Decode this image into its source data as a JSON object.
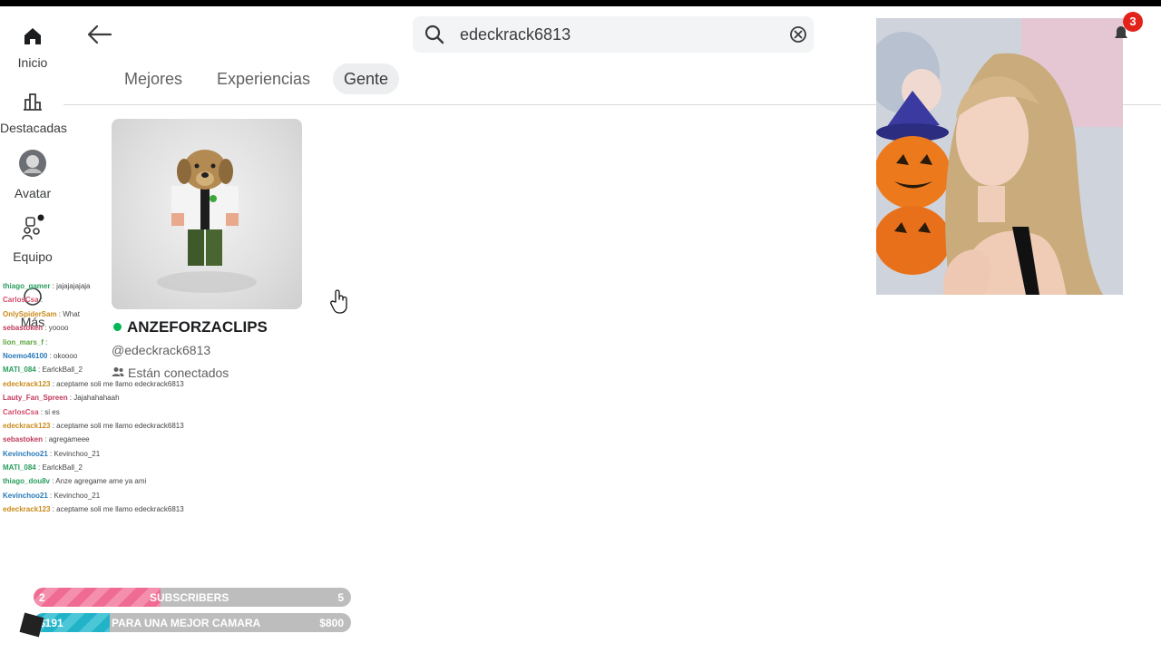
{
  "nav": {
    "items": [
      {
        "label": "Inicio",
        "icon": "home-icon"
      },
      {
        "label": "Destacadas",
        "icon": "chart-icon"
      },
      {
        "label": "Avatar",
        "icon": "avatar-icon"
      },
      {
        "label": "Equipo",
        "icon": "party-icon"
      },
      {
        "label": "Más",
        "icon": "more-icon"
      }
    ]
  },
  "search": {
    "value": "edeckrack6813",
    "icon": "search-icon",
    "clear_icon": "clear-icon"
  },
  "tabs": [
    {
      "label": "Mejores",
      "active": false
    },
    {
      "label": "Experiencias",
      "active": false
    },
    {
      "label": "Gente",
      "active": true
    }
  ],
  "result": {
    "display_name": "ANZEFORZACLIPS",
    "username": "@edeckrack6813",
    "status": "Están conectados",
    "online": true
  },
  "notifications": {
    "count": "3"
  },
  "chat": [
    {
      "user": "thiago_gamer",
      "msg": "jajajajajaja",
      "color": "#2a9d5c"
    },
    {
      "user": "CarlosCsa",
      "msg": "",
      "color": "#d44a6a"
    },
    {
      "user": "OnlySpiderSam",
      "msg": "What",
      "color": "#c98b1a"
    },
    {
      "user": "sebastoken",
      "msg": "yoooo",
      "color": "#c0395b"
    },
    {
      "user": "lion_mars_f",
      "msg": "",
      "color": "#5aa53a"
    },
    {
      "user": "Noemo46100",
      "msg": "okoooo",
      "color": "#2a7ab8"
    },
    {
      "user": "MATI_084",
      "msg": "EarlckBall_2",
      "color": "#2a9d5c"
    },
    {
      "user": "edeckrack123",
      "msg": "aceptame soli me llamo edeckrack6813",
      "color": "#c98b1a"
    },
    {
      "user": "Lauty_Fan_Spreen",
      "msg": "Jajahahahaah",
      "color": "#c0395b"
    },
    {
      "user": "CarlosCsa",
      "msg": "si es",
      "color": "#d44a6a"
    },
    {
      "user": "edeckrack123",
      "msg": "aceptame soli me llamo edeckrack6813",
      "color": "#c98b1a"
    },
    {
      "user": "sebastoken",
      "msg": "agregameee",
      "color": "#c0395b"
    },
    {
      "user": "Kevinchoo21",
      "msg": "Kevinchoo_21",
      "color": "#2a7ab8"
    },
    {
      "user": "MATI_084",
      "msg": "EarlckBall_2",
      "color": "#2a9d5c"
    },
    {
      "user": "thiago_dou8v",
      "msg": "Anze agregame ame ya ami",
      "color": "#2a9d5c"
    },
    {
      "user": "Kevinchoo21",
      "msg": "Kevinchoo_21",
      "color": "#2a7ab8"
    },
    {
      "user": "edeckrack123",
      "msg": "aceptame soli me llamo edeckrack6813",
      "color": "#c98b1a"
    }
  ],
  "goals": [
    {
      "current": "2",
      "title": "SUBSCRIBERS",
      "target": "5",
      "progress": 0.4,
      "color": "#f06b94"
    },
    {
      "current": "$191",
      "title": "PARA UNA MEJOR CAMARA",
      "target": "$800",
      "progress": 0.24,
      "color": "#22b3c8"
    }
  ]
}
